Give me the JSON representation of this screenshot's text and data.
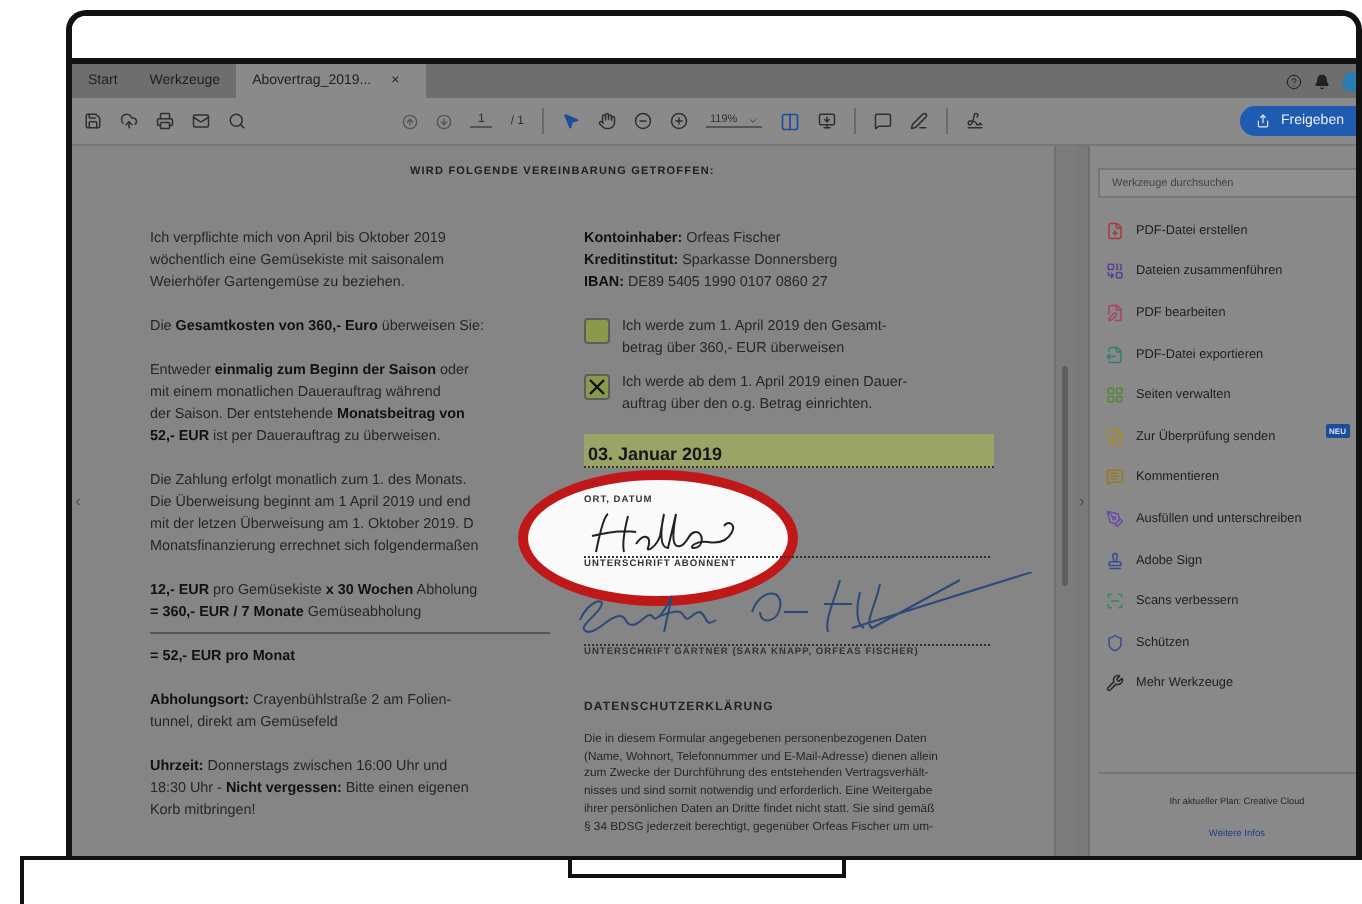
{
  "tabs": [
    {
      "label": "Start",
      "selected": false
    },
    {
      "label": "Werkzeuge",
      "selected": false
    },
    {
      "label": "Abovertrag_2019...",
      "selected": true,
      "close": "×"
    }
  ],
  "toolbar": {
    "page_current": "1",
    "page_total": "/ 1",
    "zoom": "119%",
    "share_button": "Freigeben"
  },
  "document": {
    "heading": "WIRD FOLGENDE VEREINBARUNG GETROFFEN:",
    "left_paragraphs": [
      {
        "lines": [
          "Ich verpflichte mich von April bis Oktober 2019",
          "wöchentlich eine Gemüsekiste mit saisonalem",
          "Weierhöfer Gartengemüse zu beziehen."
        ]
      },
      {
        "lines": [
          "Die **Gesamtkosten von 360,- Euro** überweisen Sie:"
        ]
      },
      {
        "lines": [
          "Entweder **einmalig zum Beginn der Saison** oder",
          "mit einem monatlichen Dauerauftrag während",
          "der Saison. Der entstehende **Monatsbeitrag von**",
          "**52,- EUR** ist per Dauerauftrag zu überweisen."
        ]
      },
      {
        "lines": [
          "Die Zahlung erfolgt monatlich zum 1. des Monats.",
          "Die Überweisung beginnt am 1 April 2019 und end",
          "mit der letzen Überweisung am 1. Oktober 2019. D",
          "Monatsfinanzierung errechnet sich folgendermaßen"
        ]
      }
    ],
    "calculation": {
      "lines": [
        "**12,- EUR** pro Gemüsekiste **x 30 Wochen** Abholung",
        "**= 360,- EUR / 7 Monate** Gemüseabholung"
      ],
      "result": "= 52,- EUR pro Monat"
    },
    "after_paragraphs": [
      {
        "lines": [
          "**Abholungsort:** Crayenbühlstraße 2 am Folien-",
          "tunnel, direkt am Gemüsefeld"
        ]
      },
      {
        "lines": [
          "**Uhrzeit:** Donnerstags zwischen 16:00 Uhr und",
          "18:30 Uhr - **Nicht vergessen:** Bitte einen eigenen",
          "Korb mitbringen!"
        ]
      }
    ],
    "account_lines": [
      "**Kontoinhaber:** Orfeas Fischer",
      "**Kreditinstitut:** Sparkasse Donnersberg",
      "**IBAN:** DE89 5405 1990 0107 0860 27"
    ],
    "options": [
      {
        "lines": [
          "Ich werde zum 1. April 2019 den Gesamt-",
          "betrag über 360,- EUR überweisen"
        ],
        "checked": false
      },
      {
        "lines": [
          "Ich werde ab dem 1. April 2019 einen Dauer-",
          "auftrag über den o.g. Betrag einrichten."
        ],
        "checked": true
      }
    ],
    "date_value": "03. Januar 2019",
    "date_label": "ORT, DATUM",
    "subscriber_signature_label": "UNTERSCHRIFT ABONNENT",
    "gardener_signature_label": "UNTERSCHRIFT GÄRTNER (SARA KNAPP, ORFEAS FISCHER)",
    "privacy_heading": "DATENSCHUTZERKLÄRUNG",
    "privacy_lines": [
      "Die in diesem Formular angegebenen personenbezogenen Daten",
      "(Name, Wohnort, Telefonnummer und E-Mail-Adresse) dienen allein",
      "zum Zwecke der Durchführung des entstehenden Vertragsverhält-",
      "nisses und sind somit notwendig und erforderlich. Eine Weitergabe",
      "ihrer persönlichen Daten an Dritte findet nicht statt. Sie sind gemäß",
      "§ 34 BDSG jederzeit berechtigt, gegenüber Orfeas Fischer um um-"
    ]
  },
  "sidebar": {
    "search_placeholder": "Werkzeuge durchsuchen",
    "tools": [
      {
        "label": "PDF-Datei erstellen",
        "color": "#a8383a"
      },
      {
        "label": "Dateien zusammenführen",
        "color": "#5a3f9a"
      },
      {
        "label": "PDF bearbeiten",
        "color": "#a8406a"
      },
      {
        "label": "PDF-Datei exportieren",
        "color": "#2c8070"
      },
      {
        "label": "Seiten verwalten",
        "color": "#4f8a30"
      },
      {
        "label": "Zur Überprüfung senden",
        "color": "#a88a20",
        "badge": "NEU"
      },
      {
        "label": "Kommentieren",
        "color": "#9a7a18"
      },
      {
        "label": "Ausfüllen und unterschreiben",
        "color": "#6a4aa8"
      },
      {
        "label": "Adobe Sign",
        "color": "#3a4a90"
      },
      {
        "label": "Scans verbessern",
        "color": "#2f8a50"
      },
      {
        "label": "Schützen",
        "color": "#3a4a98"
      },
      {
        "label": "Mehr Werkzeuge",
        "color": "#2a2a2a"
      }
    ],
    "plan": "Ihr aktueller Plan: Creative Cloud",
    "more_link": "Weitere Infos"
  }
}
